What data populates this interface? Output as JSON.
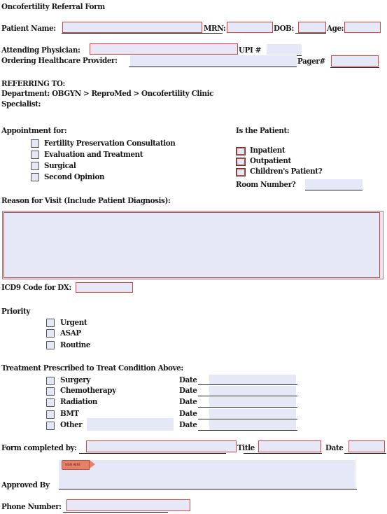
{
  "title": "Oncofertility Referral Form",
  "patient": {
    "name_label": "Patient Name:",
    "mrn_label": "MRN:",
    "dob_label": "DOB:",
    "age_label": "Age:",
    "name_value": "",
    "mrn_value": "",
    "dob_value": "",
    "age_value": ""
  },
  "physician": {
    "attending_label": "Attending Physician:",
    "upi_label": "UPI #",
    "ordering_label": "Ordering Healthcare Provider:",
    "pager_label": "Pager#"
  },
  "referring": {
    "heading": "REFERRING TO:",
    "department": "Department: OBGYN > ReproMed > Oncofertility Clinic",
    "specialist_label": "Specialist:"
  },
  "appointment": {
    "label": "Appointment for:",
    "options": [
      "Fertility Preservation Consultation",
      "Evaluation and Treatment",
      "Surgical",
      "Second Opinion"
    ]
  },
  "patient_type": {
    "label": "Is the Patient:",
    "options": [
      "Inpatient",
      "Outpatient",
      "Children's Patient?"
    ],
    "room_label": "Room Number?"
  },
  "reason": {
    "label": "Reason for Visit (Include Patient Diagnosis):",
    "value": ""
  },
  "icd9": {
    "label": "ICD9 Code for DX:",
    "value": ""
  },
  "priority": {
    "label": "Priority",
    "options": [
      "Urgent",
      "ASAP",
      "Routine"
    ]
  },
  "treatment": {
    "label": "Treatment Prescribed to Treat Condition Above:",
    "options": [
      "Surgery",
      "Chemotherapy",
      "Radiation",
      "BMT",
      "Other"
    ],
    "date_label": "Date"
  },
  "completion": {
    "completed_by_label": "Form completed by:",
    "title_label": "Title",
    "date_label": "Date",
    "sign_here": "SIGN HERE",
    "approved_by_label": "Approved By",
    "phone_label": "Phone Number:"
  },
  "colors": {
    "field_fill": "#e6e8f7",
    "required_border": "#e0403a",
    "sign_flag": "#e8816a"
  }
}
